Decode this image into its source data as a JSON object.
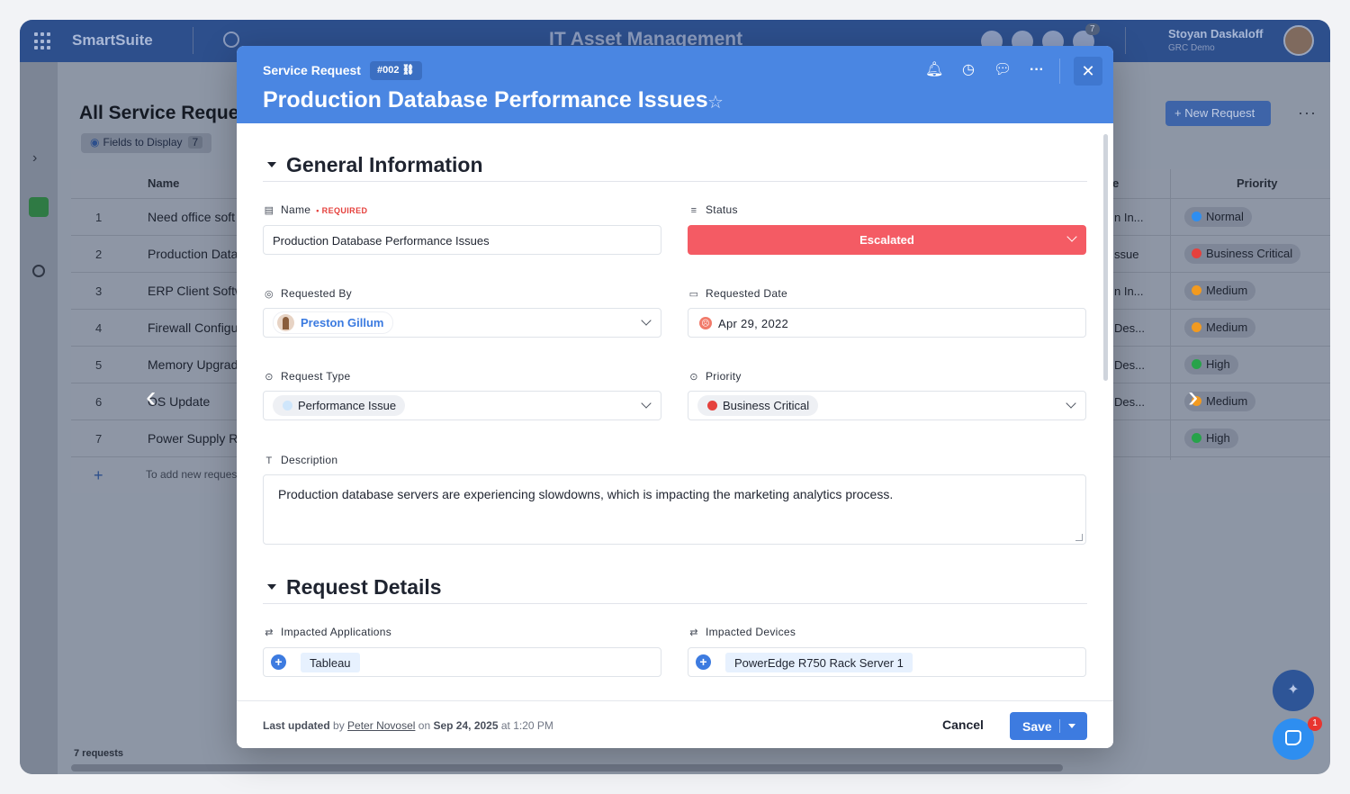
{
  "app": {
    "brand": "SmartSuite",
    "title": "IT Asset Management",
    "notif_count": "7",
    "user_name": "Stoyan Daskaloff",
    "user_org": "GRC Demo"
  },
  "background": {
    "view_title": "All Service Reque",
    "fields_label": "Fields to Display",
    "fields_count": "7",
    "col_name": "Name",
    "col_type_partial": "e",
    "col_priority": "Priority",
    "new_request": "+ New Request",
    "rows": [
      {
        "num": "1",
        "name": "Need office soft",
        "type": "n In...",
        "priority": "Normal",
        "color": "#2e8ef0"
      },
      {
        "num": "2",
        "name": "Production Data",
        "type": "ssue",
        "priority": "Business Critical",
        "color": "#e5413d"
      },
      {
        "num": "3",
        "name": "ERP Client Softw",
        "type": "n In...",
        "priority": "Medium",
        "color": "#f29a1f"
      },
      {
        "num": "4",
        "name": "Firewall Configu",
        "type": "Des...",
        "priority": "Medium",
        "color": "#f29a1f"
      },
      {
        "num": "5",
        "name": "Memory Upgrad",
        "type": "Des...",
        "priority": "High",
        "color": "#27a34a"
      },
      {
        "num": "6",
        "name": "OS Update",
        "type": "Des...",
        "priority": "Medium",
        "color": "#f29a1f"
      },
      {
        "num": "7",
        "name": "Power Supply R",
        "type": "",
        "priority": "High",
        "color": "#27a34a"
      }
    ],
    "add_hint": "To add new reques",
    "record_count": "7 requests"
  },
  "modal": {
    "record_type": "Service Request",
    "record_id": "#002",
    "title": "Production Database Performance Issues",
    "close_label": "✕",
    "sections": {
      "general": "General Information",
      "details": "Request Details"
    },
    "fields": {
      "name_label": "Name",
      "name_required": "• REQUIRED",
      "name_value": "Production Database Performance Issues",
      "status_label": "Status",
      "status_value": "Escalated",
      "status_color": "#f45b64",
      "requested_by_label": "Requested By",
      "requested_by_value": "Preston Gillum",
      "requested_date_label": "Requested Date",
      "requested_date_value": "Apr 29, 2022",
      "request_type_label": "Request Type",
      "request_type_value": "Performance Issue",
      "request_type_color": "#cfe6fb",
      "priority_label": "Priority",
      "priority_value": "Business Critical",
      "priority_color": "#e5413d",
      "description_label": "Description",
      "description_value": "Production database servers are experiencing slowdowns, which is impacting the marketing analytics process.",
      "impacted_apps_label": "Impacted Applications",
      "impacted_apps_value": "Tableau",
      "impacted_devices_label": "Impacted Devices",
      "impacted_devices_value": "PowerEdge R750 Rack Server 1"
    },
    "footer": {
      "updated_prefix": "Last updated",
      "by": "by",
      "updated_by": "Peter Novosel",
      "on": "on",
      "updated_date": "Sep 24, 2025",
      "at": "at",
      "updated_time": "1:20 PM",
      "cancel": "Cancel",
      "save": "Save"
    }
  },
  "chat_badge": "1"
}
